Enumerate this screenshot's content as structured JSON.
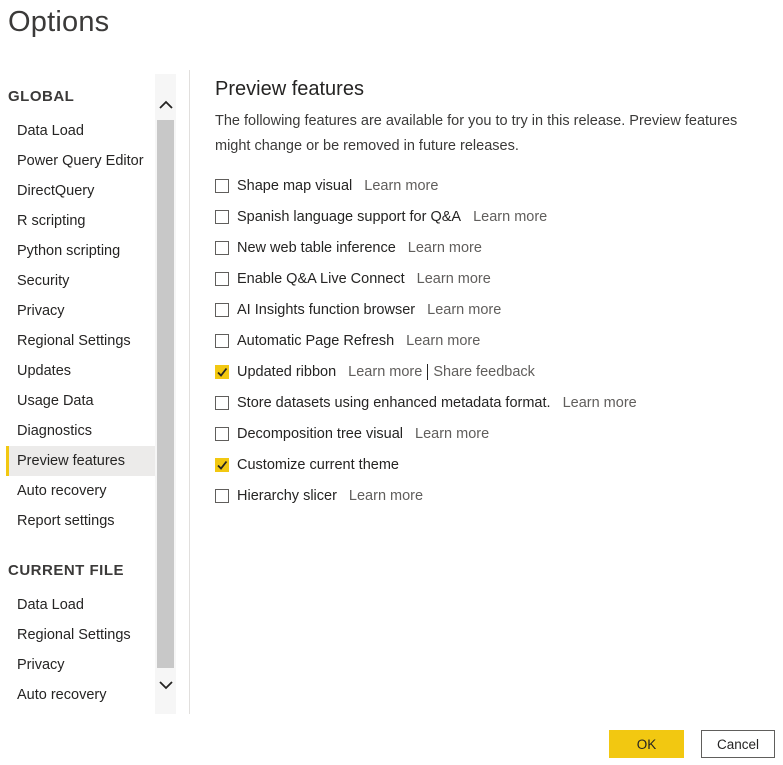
{
  "window": {
    "title": "Options"
  },
  "nav": {
    "global_heading": "GLOBAL",
    "global_items": [
      {
        "label": "Data Load"
      },
      {
        "label": "Power Query Editor"
      },
      {
        "label": "DirectQuery"
      },
      {
        "label": "R scripting"
      },
      {
        "label": "Python scripting"
      },
      {
        "label": "Security"
      },
      {
        "label": "Privacy"
      },
      {
        "label": "Regional Settings"
      },
      {
        "label": "Updates"
      },
      {
        "label": "Usage Data"
      },
      {
        "label": "Diagnostics"
      },
      {
        "label": "Preview features",
        "selected": true
      },
      {
        "label": "Auto recovery"
      },
      {
        "label": "Report settings"
      }
    ],
    "current_file_heading": "CURRENT FILE",
    "current_file_items": [
      {
        "label": "Data Load"
      },
      {
        "label": "Regional Settings"
      },
      {
        "label": "Privacy"
      },
      {
        "label": "Auto recovery"
      }
    ]
  },
  "main": {
    "heading": "Preview features",
    "description": "The following features are available for you to try in this release. Preview features might change or be removed in future releases.",
    "features": [
      {
        "label": "Shape map visual",
        "checked": false,
        "learn_more": "Learn more"
      },
      {
        "label": "Spanish language support for Q&A",
        "checked": false,
        "learn_more": "Learn more"
      },
      {
        "label": "New web table inference",
        "checked": false,
        "learn_more": "Learn more"
      },
      {
        "label": "Enable Q&A Live Connect",
        "checked": false,
        "learn_more": "Learn more"
      },
      {
        "label": "AI Insights function browser",
        "checked": false,
        "learn_more": "Learn more"
      },
      {
        "label": "Automatic Page Refresh",
        "checked": false,
        "learn_more": "Learn more"
      },
      {
        "label": "Updated ribbon",
        "checked": true,
        "learn_more": "Learn more",
        "share_feedback": "Share feedback"
      },
      {
        "label": "Store datasets using enhanced metadata format.",
        "checked": false,
        "learn_more": "Learn more"
      },
      {
        "label": "Decomposition tree visual",
        "checked": false,
        "learn_more": "Learn more"
      },
      {
        "label": "Customize current theme",
        "checked": true
      },
      {
        "label": "Hierarchy slicer",
        "checked": false,
        "learn_more": "Learn more"
      }
    ]
  },
  "footer": {
    "ok_label": "OK",
    "cancel_label": "Cancel"
  },
  "icons": {
    "scroll_up": "chevron-up-icon",
    "scroll_down": "chevron-down-icon",
    "checkmark": "checkmark-icon"
  },
  "colors": {
    "accent": "#f2c811",
    "selected_bg": "#ecebea",
    "link": "#605e5c"
  }
}
